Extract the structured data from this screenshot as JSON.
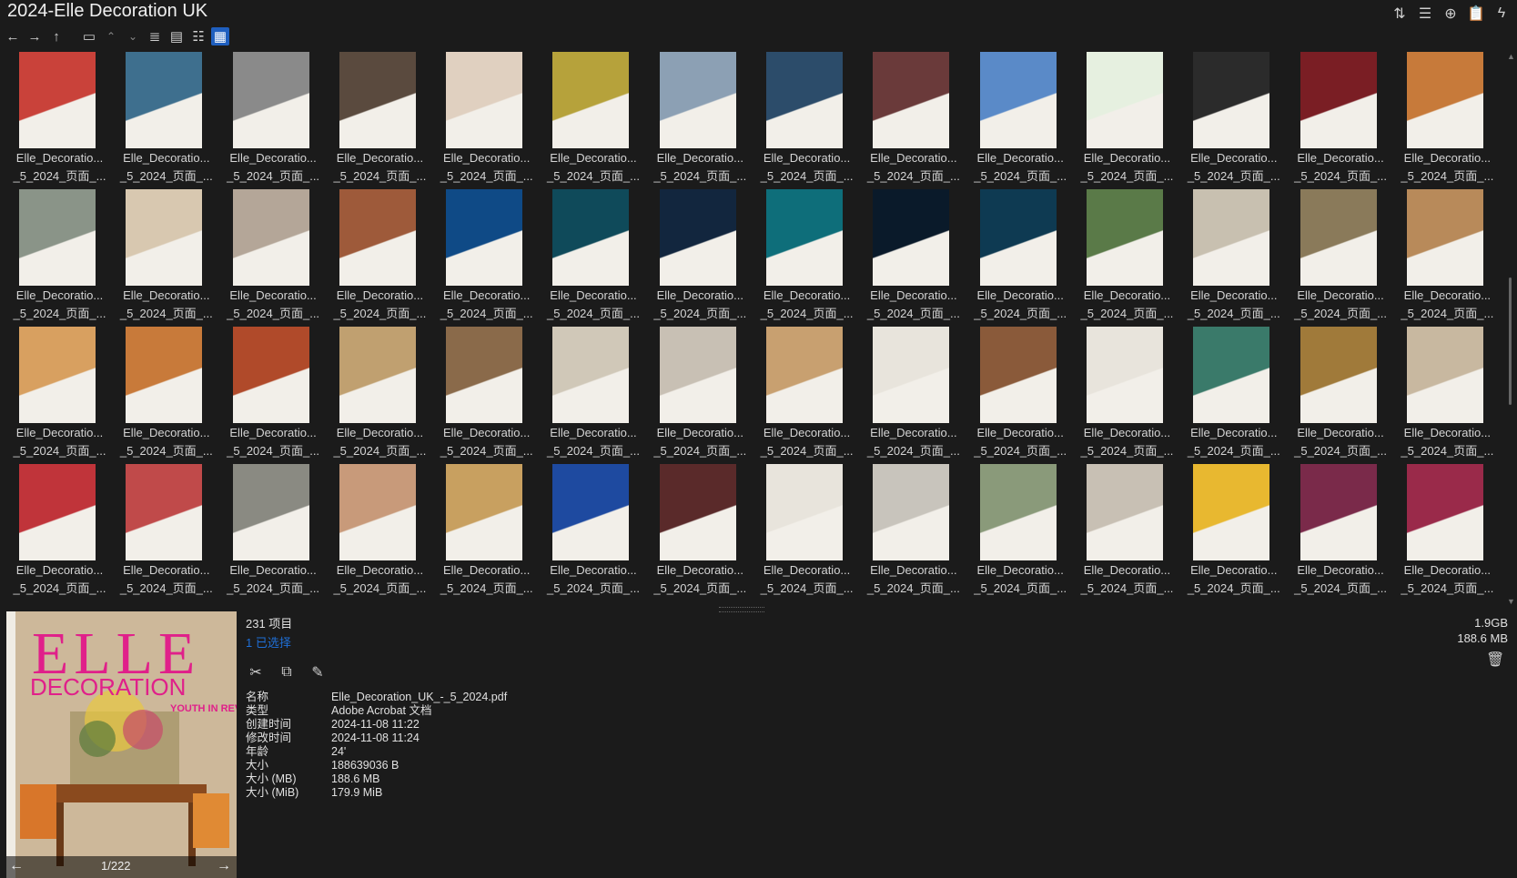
{
  "window": {
    "title": "2024-Elle Decoration UK"
  },
  "top_icons": [
    "sort-icon",
    "details-icon",
    "add-icon",
    "clipboard-icon",
    "flash-icon"
  ],
  "toolbar": {
    "back": "←",
    "forward": "→",
    "up": "↑",
    "views": [
      "list-view-icon",
      "detail-view-icon",
      "tree-view-icon",
      "thumbnail-view-icon"
    ]
  },
  "grid": {
    "caption_line1": "Elle_Decoratio...",
    "caption_line2": "_5_2024_页面_...",
    "thumb_colors": [
      "#c9423a",
      "#3e6f8e",
      "#8a8a8a",
      "#5a4a3e",
      "#e0d0c0",
      "#b6a23b",
      "#8ca0b4",
      "#2c4c6a",
      "#6a3a3a",
      "#5a8ac8",
      "#e6f0e0",
      "#2b2b2b",
      "#7a1e24",
      "#c77a3a",
      "#8a9488",
      "#d8c8b0",
      "#b4a698",
      "#9e5a3a",
      "#0f4a86",
      "#0f4a5a",
      "#12263e",
      "#0e6e7a",
      "#0a1a2a",
      "#0e3a52",
      "#5a7a48",
      "#c8c0b0",
      "#8a7a5a",
      "#b88a5a",
      "#d8a060",
      "#c87a3a",
      "#b04a2a",
      "#c0a070",
      "#8a6a4a",
      "#d0c8b8",
      "#c8c0b4",
      "#c8a070",
      "#e8e4dc",
      "#8a5a3a",
      "#e8e4dc",
      "#3a7a6a",
      "#a07a3a",
      "#c8b8a0",
      "#c0343a",
      "#c04a4a",
      "#8a8a82",
      "#c89a7a",
      "#c8a060",
      "#1e4aa0",
      "#5a2a2a",
      "#e8e4dc",
      "#c8c4bc",
      "#8a9a7a",
      "#c8c0b4",
      "#e8b830",
      "#7a2a4a",
      "#9a2a4a"
    ]
  },
  "preview": {
    "page": "1/222",
    "prev": "←",
    "next": "→",
    "brand": "ELLE",
    "sub": "DECORATION",
    "headline": "YOUTH IN REVOLT"
  },
  "info": {
    "count": "231 项目",
    "selected": "1 已选择",
    "actions": [
      "cut-icon",
      "copy-icon",
      "rename-icon"
    ],
    "props": [
      {
        "k": "名称",
        "v": "Elle_Decoration_UK_-_5_2024.pdf"
      },
      {
        "k": "类型",
        "v": "Adobe Acrobat 文档"
      },
      {
        "k": "创建时间",
        "v": "2024-11-08  11:22"
      },
      {
        "k": "修改时间",
        "v": "2024-11-08  11:24"
      },
      {
        "k": "年龄",
        "v": "24'"
      },
      {
        "k": "大小",
        "v": "188639036 B"
      },
      {
        "k": "大小 (MB)",
        "v": "188.6 MB"
      },
      {
        "k": "大小 (MiB)",
        "v": "179.9 MiB"
      }
    ]
  },
  "totals": {
    "total": "1.9GB",
    "selected_size": "188.6 MB"
  }
}
